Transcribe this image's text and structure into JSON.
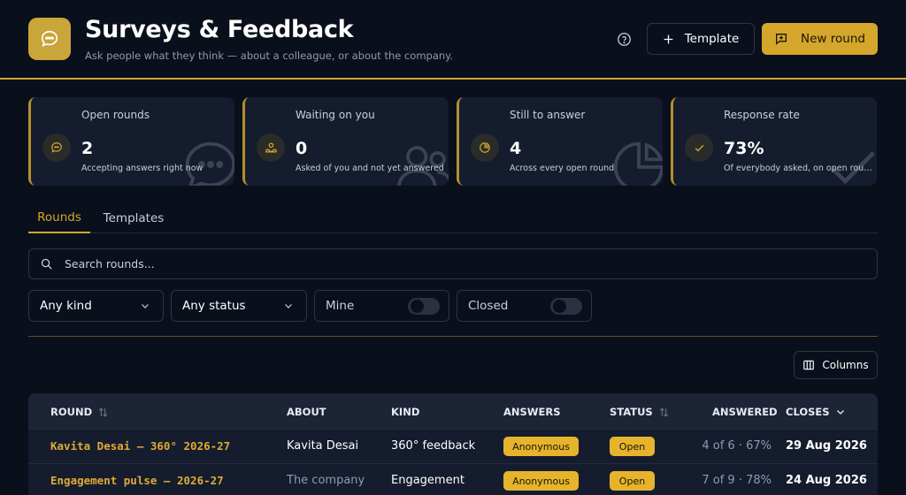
{
  "header": {
    "title": "Surveys & Feedback",
    "subtitle": "Ask people what they think — about a colleague, or about the company.",
    "template_label": "Template",
    "new_round_label": "New round"
  },
  "stats": [
    {
      "label": "Open rounds",
      "value": "2",
      "sub": "Accepting answers right now",
      "icon": "chat-bubble-icon"
    },
    {
      "label": "Waiting on you",
      "value": "0",
      "sub": "Asked of you and not yet answered",
      "icon": "person-inbox-icon"
    },
    {
      "label": "Still to answer",
      "value": "4",
      "sub": "Across every open round",
      "icon": "pie-chart-icon"
    },
    {
      "label": "Response rate",
      "value": "73%",
      "sub": "Of everybody asked, on open rounds",
      "icon": "check-icon"
    }
  ],
  "tabs": [
    {
      "label": "Rounds",
      "active": true
    },
    {
      "label": "Templates",
      "active": false
    }
  ],
  "search": {
    "placeholder": "Search rounds..."
  },
  "filters": {
    "kind": "Any kind",
    "status": "Any status",
    "mine": "Mine",
    "closed": "Closed"
  },
  "columns_label": "Columns",
  "table": {
    "headers": [
      "ROUND",
      "ABOUT",
      "KIND",
      "ANSWERS",
      "STATUS",
      "ANSWERED",
      "CLOSES"
    ],
    "rows": [
      {
        "round": "Kavita Desai — 360° 2026-27",
        "about": "Kavita Desai",
        "kind": "360° feedback",
        "answers": "Anonymous",
        "status": "Open",
        "answered": "4 of 6 · 67%",
        "closes": "29 Aug 2026"
      },
      {
        "round": "Engagement pulse — 2026-27",
        "about": "The company",
        "kind": "Engagement",
        "answers": "Anonymous",
        "status": "Open",
        "answered": "7 of 9 · 78%",
        "closes": "24 Aug 2026"
      }
    ]
  },
  "colors": {
    "accent": "#d4a72c",
    "background": "#0a0f1c",
    "card": "#141c2e"
  }
}
